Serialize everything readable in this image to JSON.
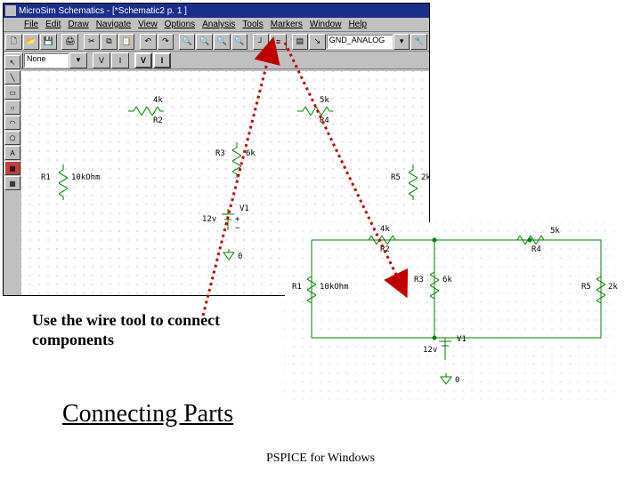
{
  "titlebar": {
    "app_name": "MicroSim Schematics",
    "document": "[*Schematic2  p. 1 ]"
  },
  "menu": {
    "items": [
      "File",
      "Edit",
      "Draw",
      "Navigate",
      "View",
      "Options",
      "Analysis",
      "Tools",
      "Markers",
      "Window",
      "Help"
    ]
  },
  "toolbar1": {
    "part_dropdown": "GND_ANALOG"
  },
  "toolbar2": {
    "name_field": "None"
  },
  "schematic_main": {
    "components": {
      "R1": {
        "name": "R1",
        "value": "10kOhm"
      },
      "R2": {
        "name": "R2",
        "value": "4k"
      },
      "R3": {
        "name": "R3",
        "value": "6k"
      },
      "R4": {
        "name": "R4",
        "value": "5k"
      },
      "R5": {
        "name": "R5",
        "value": "2k"
      },
      "V1": {
        "name": "V1",
        "value": "12v"
      },
      "GND": {
        "name": "0"
      }
    }
  },
  "schematic_mini": {
    "components": {
      "R1": {
        "name": "R1",
        "value": "10kOhm"
      },
      "R2": {
        "name": "R2",
        "value": "4k"
      },
      "R3": {
        "name": "R3",
        "value": "6k"
      },
      "R4": {
        "name": "R4",
        "value": "5k"
      },
      "R5": {
        "name": "R5",
        "value": "2k"
      },
      "V1": {
        "name": "V1",
        "value": "12v"
      },
      "GND": {
        "name": "0"
      }
    }
  },
  "callout_text_line1": "Use the wire tool to connect",
  "callout_text_line2": "components",
  "heading_text": "Connecting Parts",
  "footer_text": "PSPICE for Windows"
}
